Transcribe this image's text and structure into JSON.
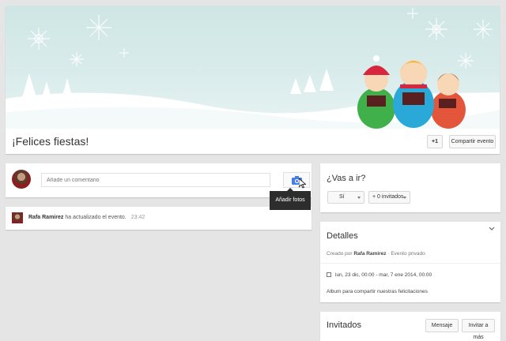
{
  "event": {
    "title": "¡Felices fiestas!",
    "plus_one": "+1",
    "share": "Compartir evento"
  },
  "comment": {
    "placeholder": "Añade un comentario",
    "add_photos_tooltip": "Añadir fotos"
  },
  "activity": {
    "user": "Rafa Ramirez",
    "action": "ha actualizado el evento.",
    "time": "23:42"
  },
  "rsvp": {
    "question": "¿Vas a ir?",
    "answer": "Sí",
    "guests": "+ 0 invitados"
  },
  "details": {
    "title": "Detalles",
    "created_by_label": "Creado por",
    "creator": "Rafa Ramirez",
    "separator": "·",
    "privacy": "Evento privado",
    "dates": "lun, 23 dic, 00:00 - mar, 7 ene 2014, 00:00",
    "description": "Album para compartir nuestras felicitaciones"
  },
  "invitees": {
    "title": "Invitados",
    "message": "Mensaje",
    "invite_more": "Invitar a más"
  },
  "colors": {
    "accent": "#427fed",
    "cover_bg": "#d5eae9",
    "tooltip_bg": "#2d2d2d"
  }
}
